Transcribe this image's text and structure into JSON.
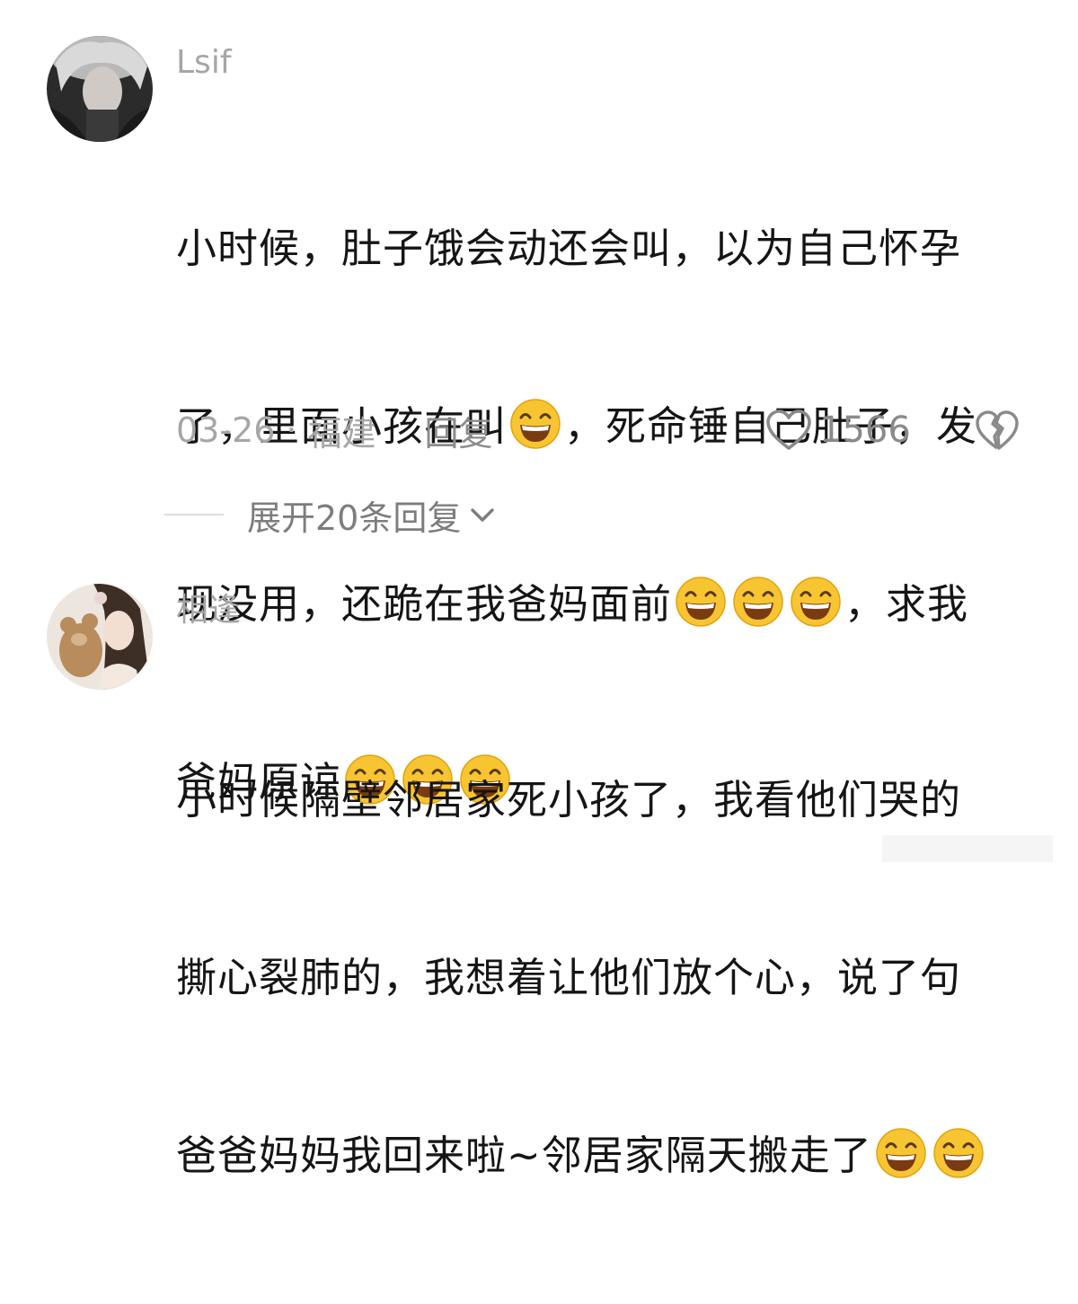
{
  "comments": [
    {
      "username": "Lsif",
      "lines": [
        "小时候，肚子饿会动还会叫，以为自己怀孕",
        [
          "了，里面小孩在叫",
          "，死命锤自己肚子，发"
        ],
        [
          "现没用，还跪在我爸妈面前",
          "，求我"
        ],
        [
          "爸妈原谅",
          ""
        ]
      ],
      "date": "03-26",
      "dot": "·",
      "location": "福建",
      "reply_label": "回复",
      "like_count": "1566",
      "expand_label": "展开20条回复"
    },
    {
      "username": "相逢",
      "lines": [
        "小时候隔壁邻居家死小孩了，我看他们哭的",
        "撕心裂肺的，我想着让他们放个心，说了句",
        "爸爸妈妈我回来啦~邻居家隔天搬走了"
      ]
    }
  ],
  "icons": {
    "emoji": "grinning-squint-emoji",
    "like": "heart-outline-icon",
    "dislike": "broken-heart-icon",
    "expand": "chevron-down-icon"
  },
  "colors": {
    "emoji_face": "#f7c531",
    "emoji_outline": "#e3a20f",
    "muted_text": "#a6a6a6"
  }
}
